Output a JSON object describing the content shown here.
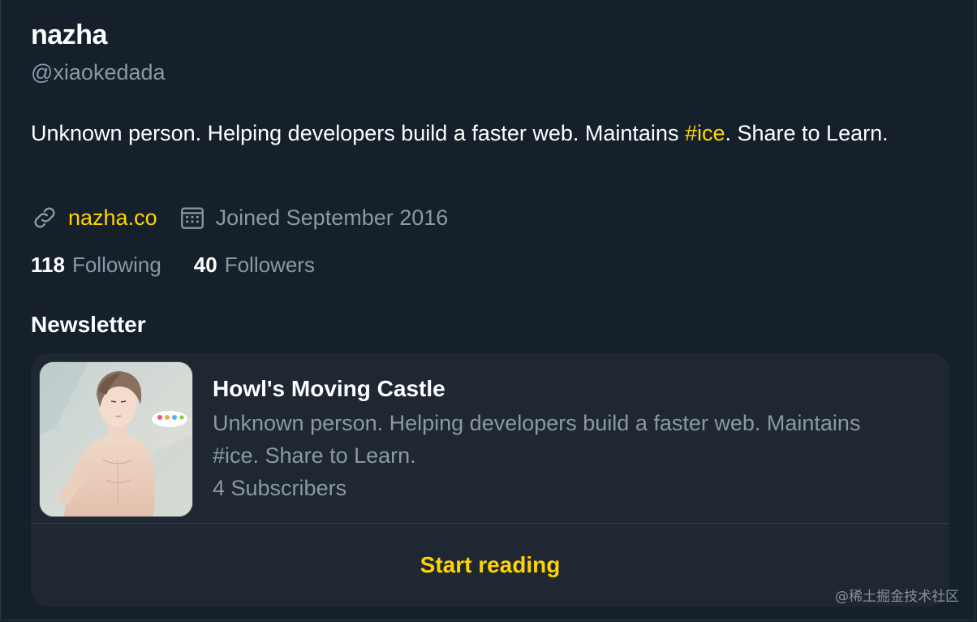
{
  "profile": {
    "name": "nazha",
    "handle": "@xiaokedada",
    "bio_prefix": "Unknown person. Helping developers build a faster web. Maintains ",
    "bio_hashtag": "#ice",
    "bio_suffix": ". Share to Learn."
  },
  "meta": {
    "link_icon": "link-icon",
    "website": "nazha.co",
    "calendar_icon": "calendar-icon",
    "joined": "Joined September 2016"
  },
  "stats": {
    "following_count": "118",
    "following_label": "Following",
    "followers_count": "40",
    "followers_label": "Followers"
  },
  "newsletter": {
    "section_title": "Newsletter",
    "title": "Howl's Moving Castle",
    "description": "Unknown person. Helping developers build a faster web. Maintains  #ice. Share to Learn.",
    "subscribers": "4 Subscribers",
    "cta": "Start reading"
  },
  "watermark": "@稀土掘金技术社区",
  "colors": {
    "background": "#15202b",
    "card": "#1e2732",
    "accent": "#ffd400",
    "secondary_text": "#8b98a5",
    "primary_text": "#ffffff"
  }
}
